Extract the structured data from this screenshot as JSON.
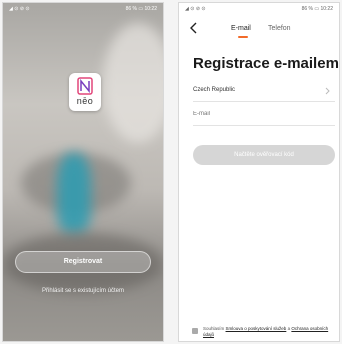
{
  "left_screen": {
    "status": {
      "left": "◢ ⊙ ⊘ ⊙",
      "right": "86 % ▭ 10:22"
    },
    "logo": {
      "brand": "nēo"
    },
    "register_button": "Registrovat",
    "login_link": "Přihlásit se s existujícím účtem"
  },
  "right_screen": {
    "status": {
      "left": "◢ ⊙ ⊘ ⊙",
      "right": "86 % ▭ 10:22"
    },
    "tabs": [
      {
        "label": "E-mail",
        "active": true
      },
      {
        "label": "Telefon",
        "active": false
      }
    ],
    "title": "Registrace e-mailem",
    "country": "Czech Republic",
    "email_placeholder": "E-mail",
    "code_button": "Načtěte ověřovací kód",
    "consent": {
      "prefix": "Souhlasím",
      "link1": "Smlouva o poskytování služeb",
      "conj": "a",
      "link2": "Ochrana osobních údajů"
    }
  },
  "colors": {
    "accent": "#f26b2a",
    "disabled_button": "#d6d6d6"
  }
}
